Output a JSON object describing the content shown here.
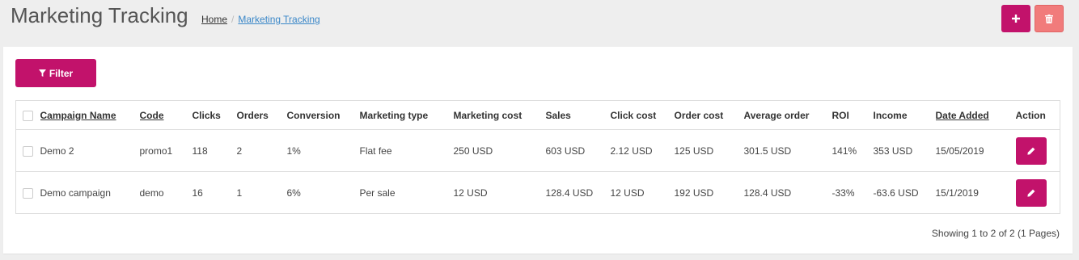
{
  "header": {
    "title": "Marketing Tracking",
    "breadcrumb": [
      {
        "label": "Home"
      },
      {
        "label": "Marketing Tracking"
      }
    ],
    "add_icon": "plus-icon",
    "delete_icon": "trash-icon"
  },
  "filter": {
    "label": "Filter",
    "icon": "filter-icon"
  },
  "table": {
    "columns": [
      "Campaign Name",
      "Code",
      "Clicks",
      "Orders",
      "Conversion",
      "Marketing type",
      "Marketing cost",
      "Sales",
      "Click cost",
      "Order cost",
      "Average order",
      "ROI",
      "Income",
      "Date Added",
      "Action"
    ],
    "rows": [
      {
        "campaign_name": "Demo 2",
        "code": "promo1",
        "clicks": "118",
        "orders": "2",
        "conversion": "1%",
        "marketing_type": "Flat fee",
        "marketing_cost": "250 USD",
        "sales": "603 USD",
        "click_cost": "2.12 USD",
        "order_cost": "125 USD",
        "average_order": "301.5 USD",
        "roi": "141%",
        "income": "353 USD",
        "date_added": "15/05/2019"
      },
      {
        "campaign_name": "Demo campaign",
        "code": "demo",
        "clicks": "16",
        "orders": "1",
        "conversion": "6%",
        "marketing_type": "Per sale",
        "marketing_cost": "12 USD",
        "sales": "128.4 USD",
        "click_cost": "12 USD",
        "order_cost": "192 USD",
        "average_order": "128.4 USD",
        "roi": "-33%",
        "income": "-63.6 USD",
        "date_added": "15/1/2019"
      }
    ],
    "edit_icon": "pencil-icon"
  },
  "pagination": {
    "info": "Showing 1 to 2 of 2 (1 Pages)"
  },
  "colors": {
    "primary": "#c2126b",
    "danger": "#f17b7b",
    "link": "#3a87c8"
  }
}
